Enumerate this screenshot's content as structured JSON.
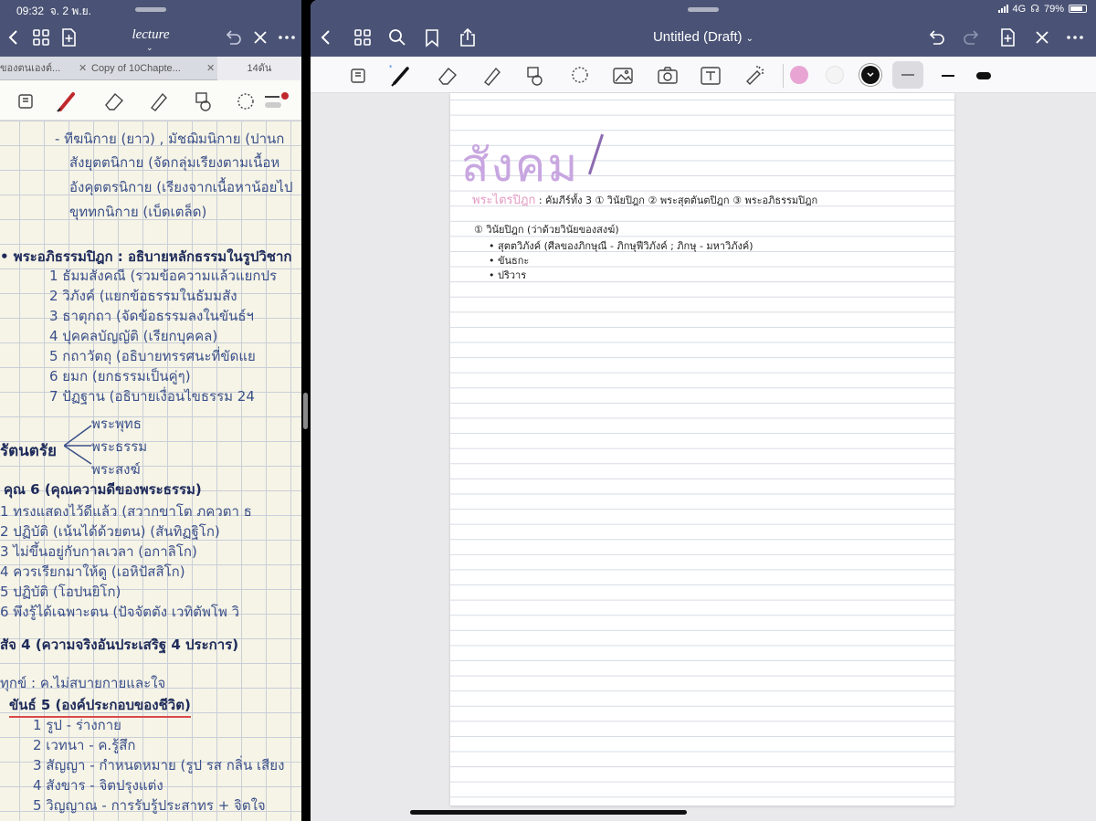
{
  "status": {
    "time": "09:32",
    "date": "จ. 2 พ.ย.",
    "network": "4G",
    "battery": "79%",
    "battery_level": 0.79
  },
  "left": {
    "title": "lecture",
    "tabs": [
      "ของตนเองต์...",
      "Copy of 10Chapte...",
      "14ดัน"
    ],
    "notes": [
      "- ทีฆนิกาย (ยาว) , มัชฌิมนิกาย (ปานก",
      "สังยุตตนิกาย (จัดกลุ่มเรียงตามเนื้อห",
      "อังคุตตรนิกาย (เรียงจากเนื้อหาน้อยไป",
      "ขุททกนิกาย (เบ็ดเตล็ด)",
      "• พระอภิธรรมปิฎก : อธิบายหลักธรรมในรูปวิชาก",
      "1 ธัมมสังคณี (รวมข้อความแล้วแยกปร",
      "2 วิภังค์ (แยกข้อธรรมในธัมมสัง",
      "3 ธาตุกถา (จัดข้อธรรมลงในขันธ์ฯ",
      "4 ปุคคลบัญญัติ (เรียกบุคคล)",
      "5 กถาวัตถุ (อธิบายทรรศนะที่ขัดแย",
      "6 ยมก (ยกธรรมเป็นคู่ๆ)",
      "7 ปัฏฐาน (อธิบายเงื่อนไขธรรม 24",
      "พระพุทธ",
      "รัตนตรัย",
      "พระธรรม",
      "พระสงฆ์",
      "คุณ 6 (คุณความดีของพระธรรม)",
      "1 ทรงแสดงไว้ดีแล้ว (สวากขาโต ภควตา ธ",
      "2 ปฏิบัติ (เน้นได้ด้วยตน) (สันทิฏฐิโก)",
      "3 ไม่ขึ้นอยู่กับกาลเวลา (อกาลิโก)",
      "4 ควรเรียกมาให้ดู (เอหิปัสสิโก)",
      "5 ปฏิบัติ (โอปนยิโก)",
      "6 พึงรู้ได้เฉพาะตน (ปัจจัตตัง เวทิตัพโพ วิ",
      "สัจ 4 (ความจริงอันประเสริฐ 4 ประการ)",
      "ทุกข์ : ค.ไม่สบายกายและใจ",
      "ขันธ์ 5 (องค์ประกอบของชีวิต)",
      "1 รูป - ร่างกาย",
      "2 เวทนา - ค.รู้สึก",
      "3 สัญญา - กำหนดหมาย (รูป รส กลิ่น เสียง",
      "4 สังขาร - จิตปรุงแต่ง",
      "5 วิญญาณ - การรับรู้ประสาทร + จิตใจ"
    ]
  },
  "right": {
    "doc_title": "Untitled (Draft)",
    "colors": {
      "swatch_1": "#e8a5d4",
      "swatch_2": "#f4f4f4",
      "swatch_3": "#111111",
      "nav_bg": "#4a5375",
      "title_color": "#c8a6e0"
    },
    "page": {
      "big_title": "สังคม",
      "line1_label": "พระไตรปิฎก",
      "line1_text": ": คัมภีร์ทั้ง 3 ① วินัยปิฎก ② พระสุตตันตปิฎก ③ พระอภิธรรมปิฎก",
      "line2": "① วินัยปิฎก (ว่าด้วยวินัยของสงฆ์)",
      "bullet1": "• สุตตวิภังค์ (ศีลของภิกษุณี - ภิกษุฟีวิภังค์ ; ภิกษุ - มหาวิภังค์)",
      "bullet2": "• ขันธกะ",
      "bullet3": "• ปริวาร"
    }
  }
}
